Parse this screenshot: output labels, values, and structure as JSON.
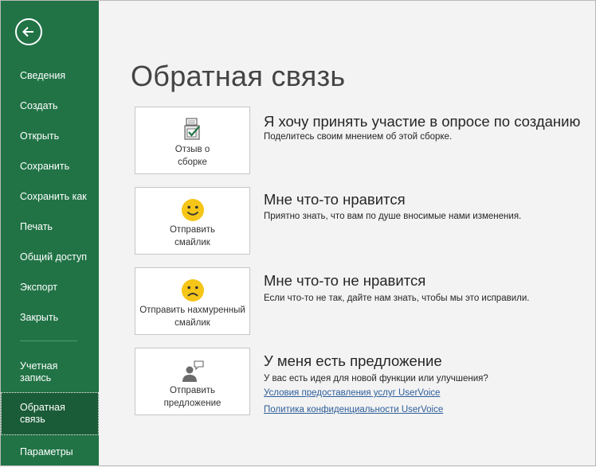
{
  "sidebar": {
    "back_icon": "back-arrow-icon",
    "items": [
      {
        "label": "Сведения"
      },
      {
        "label": "Создать"
      },
      {
        "label": "Открыть"
      },
      {
        "label": "Сохранить"
      },
      {
        "label": "Сохранить как"
      },
      {
        "label": "Печать"
      },
      {
        "label": "Общий доступ"
      },
      {
        "label": "Экспорт"
      },
      {
        "label": "Закрыть"
      },
      {
        "label": "Учетная\nзапись"
      },
      {
        "label": "Обратная\nсвязь",
        "selected": true
      },
      {
        "label": "Параметры"
      }
    ]
  },
  "main": {
    "title": "Обратная связь",
    "sections": [
      {
        "tile_label": "Отзыв о\nсборке",
        "tile_icon": "survey-checkbox-icon",
        "title": "Я хочу принять участие в опросе по созданию",
        "desc": "Поделитесь своим мнением об этой сборке."
      },
      {
        "tile_label": "Отправить\nсмайлик",
        "tile_icon": "smile-icon",
        "title": "Мне что-то нравится",
        "desc": "Приятно знать, что вам по душе вносимые нами изменения."
      },
      {
        "tile_label": "Отправить нахмуренный\nсмайлик",
        "tile_icon": "frown-icon",
        "title": "Мне что-то не нравится",
        "desc": "Если что-то не так, дайте нам знать, чтобы мы это исправили."
      },
      {
        "tile_label": "Отправить\nпредложение",
        "tile_icon": "person-speech-icon",
        "title": "У меня есть предложение",
        "desc": "У вас есть идея для новой функции или улучшения?",
        "links": [
          "Условия предоставления услуг UserVoice",
          "Политика конфиденциальности UserVoice"
        ]
      }
    ]
  },
  "colors": {
    "sidebar_bg": "#217346",
    "sidebar_selected": "#1a5c37",
    "smiley": "#f5c518",
    "link": "#2e5e9a"
  }
}
